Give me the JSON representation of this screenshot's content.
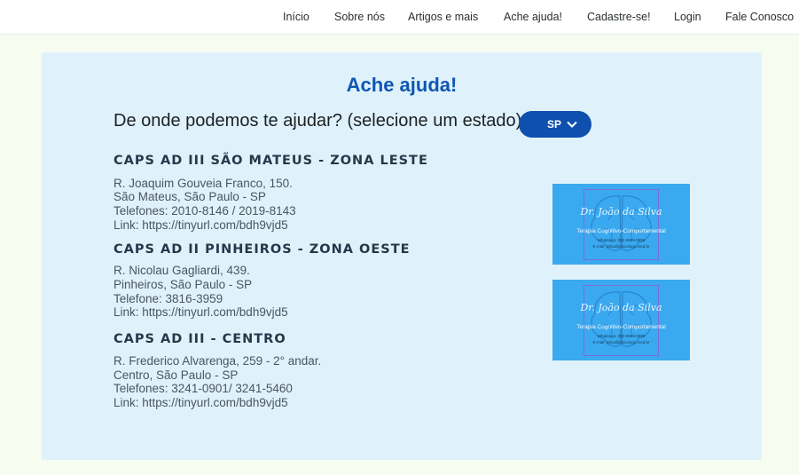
{
  "nav": {
    "items": [
      "Início",
      "Sobre nós",
      "Artigos e mais",
      "Ache ajuda!",
      "Cadastre-se!",
      "Login",
      "Fale Conosco"
    ]
  },
  "page": {
    "title": "Ache ajuda!",
    "question": "De onde podemos te ajudar? (selecione um estado)",
    "state_selected": "SP"
  },
  "centers": [
    {
      "name": "CAPS AD III SÃO MATEUS - ZONA LESTE",
      "lines": [
        "R. Joaquim Gouveia Franco, 150.",
        "São Mateus, São Paulo - SP",
        "Telefones: 2010-8146 / 2019-8143",
        "Link: https://tinyurl.com/bdh9vjd5"
      ]
    },
    {
      "name": "CAPS AD II PINHEIROS - ZONA OESTE",
      "lines": [
        "R. Nicolau Gagliardi, 439.",
        "Pinheiros, São Paulo - SP",
        "Telefone: 3816-3959",
        "Link: https://tinyurl.com/bdh9vjd5"
      ]
    },
    {
      "name": "CAPS AD III - CENTRO",
      "lines": [
        "R. Frederico Alvarenga, 259 - 2° andar.",
        "Centro, São Paulo - SP",
        "Telefones: 3241-0901/ 3241-5460",
        "Link: https://tinyurl.com/bdh9vjd5"
      ]
    }
  ],
  "cards": [
    {
      "name": "Dr. João da Silva",
      "specialty": "Terapia Cognitivo-Comportamental",
      "whatsapp": "Whatsapp: (99) 9999-9999",
      "email": "E-mail: jsilva@psicologo.med.br"
    },
    {
      "name": "Dr. João da Silva",
      "specialty": "Terapia Cognitivo-Comportamental",
      "whatsapp": "Whatsapp: (99) 9999-9999",
      "email": "E-mail: jsilva@psicologo.med.br"
    }
  ],
  "colors": {
    "accent": "#0f56b3",
    "panel_bg": "#dff2fb",
    "card_bg": "#3aa9f0",
    "page_bg": "#f7fcf1"
  },
  "icons": {
    "dropdown": "chevron-down-icon",
    "card_graphic": "brain-icon"
  }
}
